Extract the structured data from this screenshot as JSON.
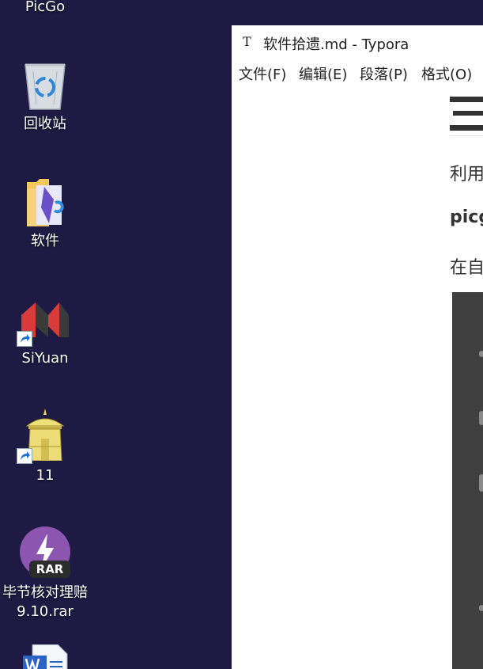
{
  "desktop": {
    "icons": [
      {
        "label": "PicGo"
      },
      {
        "label": "回收站"
      },
      {
        "label": "软件"
      },
      {
        "label": "SiYuan"
      },
      {
        "label": "11"
      },
      {
        "label_line1": "毕节核对理赔",
        "label_line2": "9.10.rar",
        "badge": "RAR"
      }
    ]
  },
  "window": {
    "app_icon": "T",
    "title": "软件拾遗.md - Typora",
    "menu": [
      "文件(F)",
      "编辑(E)",
      "段落(P)",
      "格式(O)"
    ]
  },
  "document": {
    "para1": "利用",
    "para2": "picg",
    "para3": "在自"
  },
  "colors": {
    "desktop_bg": "#1e1a43",
    "window_bg": "#ffffff",
    "code_bg": "#3f3f3f"
  }
}
